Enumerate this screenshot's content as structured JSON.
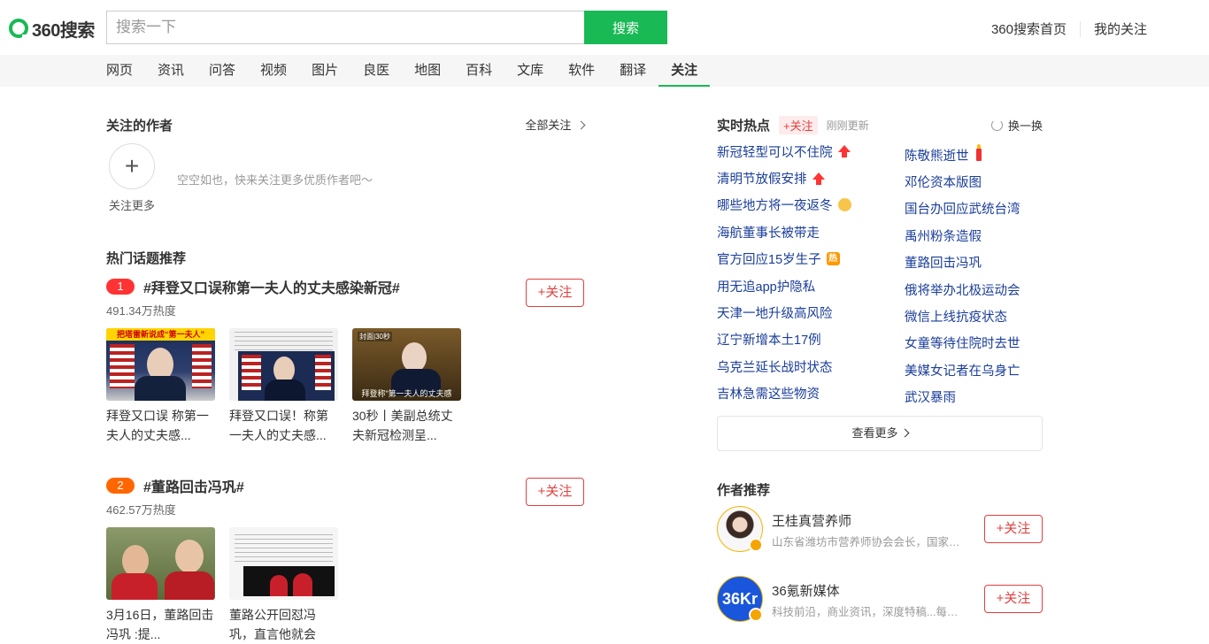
{
  "header": {
    "logo_text": "360搜索",
    "search_placeholder": "搜索一下",
    "search_button": "搜索",
    "links": [
      "360搜索首页",
      "我的关注"
    ]
  },
  "nav": {
    "items": [
      "网页",
      "资讯",
      "问答",
      "视频",
      "图片",
      "良医",
      "地图",
      "百科",
      "文库",
      "软件",
      "翻译",
      "关注"
    ],
    "active": "关注"
  },
  "authors_section": {
    "title": "关注的作者",
    "all_follow": "全部关注",
    "follow_more": "关注更多",
    "empty_tip": "空空如也，快来关注更多优质作者吧～"
  },
  "hot_topics": {
    "title": "热门话题推荐",
    "follow_label": "+关注",
    "items": [
      {
        "rank": "1",
        "name": "#拜登又口误称第一夫人的丈夫感染新冠#",
        "heat": "491.34万热度",
        "thumbs": [
          {
            "caption_l1": "拜登又口误 称第一",
            "caption_l2": "夫人的丈夫感...",
            "banner": "把塔雷新说成“第一夫人”"
          },
          {
            "caption_l1": "拜登又口误！称第",
            "caption_l2": "一夫人的丈夫感..."
          },
          {
            "caption_l1": "30秒丨美副总统丈",
            "caption_l2": "夫新冠检测呈...",
            "tag": "封面|30秒",
            "overlay": "拜登称“第一夫人的丈夫感"
          }
        ]
      },
      {
        "rank": "2",
        "name": "#董路回击冯巩#",
        "heat": "462.57万热度",
        "thumbs": [
          {
            "caption_l1": "3月16日，董路回击",
            "caption_l2": "冯巩 :提..."
          },
          {
            "caption_l1": "董路公开回怼冯",
            "caption_l2": "巩，直言他就会"
          }
        ]
      }
    ]
  },
  "realtime": {
    "title": "实时热点",
    "follow": "+关注",
    "updated": "刚刚更新",
    "refresh": "换一换",
    "col1": [
      {
        "text": "新冠轻型可以不住院",
        "badge": "up"
      },
      {
        "text": "清明节放假安排",
        "badge": "up"
      },
      {
        "text": "哪些地方将一夜返冬",
        "badge": "face"
      },
      {
        "text": "海航董事长被带走",
        "badge": ""
      },
      {
        "text": "官方回应15岁生子",
        "badge": "hot"
      },
      {
        "text": "用无追app护隐私",
        "badge": ""
      },
      {
        "text": "天津一地升级高风险",
        "badge": ""
      },
      {
        "text": "辽宁新增本土17例",
        "badge": ""
      },
      {
        "text": "乌克兰延长战时状态",
        "badge": ""
      },
      {
        "text": "吉林急需这些物资",
        "badge": ""
      }
    ],
    "col2": [
      {
        "text": "陈敬熊逝世",
        "badge": "candle"
      },
      {
        "text": "邓伦资本版图",
        "badge": ""
      },
      {
        "text": "国台办回应武统台湾",
        "badge": ""
      },
      {
        "text": "禹州粉条造假",
        "badge": ""
      },
      {
        "text": "董路回击冯巩",
        "badge": ""
      },
      {
        "text": "俄将举办北极运动会",
        "badge": ""
      },
      {
        "text": "微信上线抗疫状态",
        "badge": ""
      },
      {
        "text": "女童等待住院时去世",
        "badge": ""
      },
      {
        "text": "美媒女记者在乌身亡",
        "badge": ""
      },
      {
        "text": "武汉暴雨",
        "badge": ""
      }
    ],
    "hot_badge_text": "热",
    "more": "查看更多"
  },
  "author_rec": {
    "title": "作者推荐",
    "follow_label": "+关注",
    "items": [
      {
        "name": "王桂真营养师",
        "desc": "山东省潍坊市营养师协会会长，国家一级营养师"
      },
      {
        "name": "36氪新媒体",
        "desc": "科技前沿，商业资讯，深度特稿...每一天",
        "avatar_text": "36Kr"
      }
    ]
  },
  "colors": {
    "brand_green": "#19b955",
    "follow_red": "#e0403f",
    "link_blue": "#1a3d9a"
  }
}
